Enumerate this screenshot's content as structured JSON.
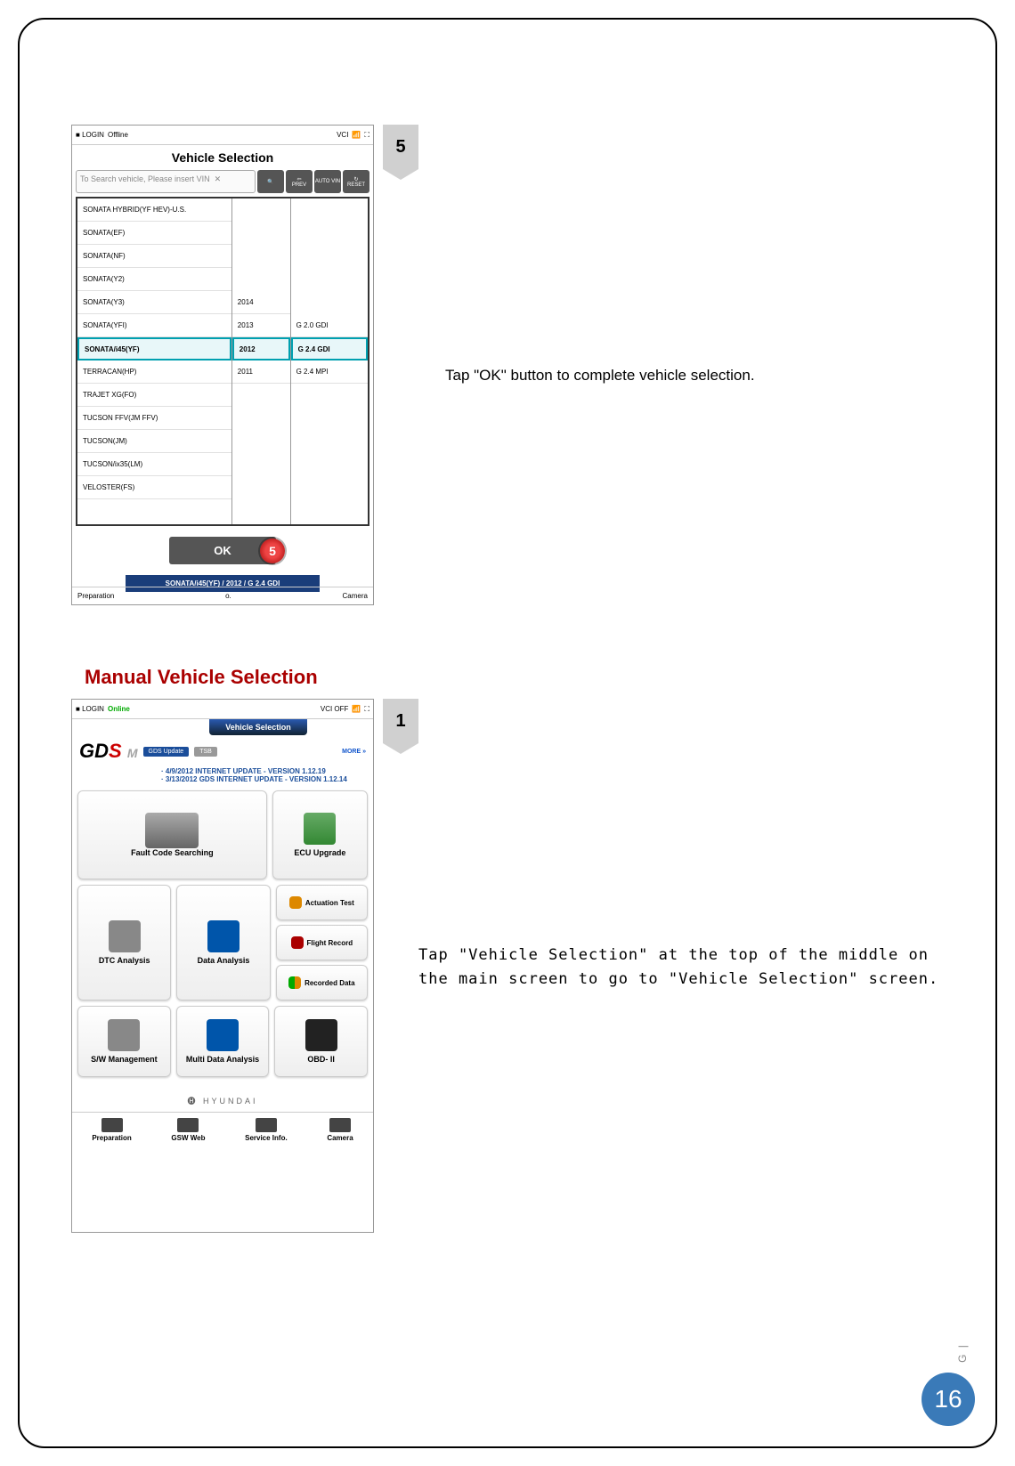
{
  "page_number": "16",
  "side_label": "G |",
  "section_title": "Manual Vehicle Selection",
  "steps": {
    "s5": {
      "num": "5",
      "text": "Tap \"OK\" button to complete vehicle selection."
    },
    "s1": {
      "num": "1",
      "text": "Tap \"Vehicle Selection\" at the top of the middle on the main screen to go to \"Vehicle Selection\" screen."
    }
  },
  "ss1": {
    "login": "LOGIN",
    "status": "Offline",
    "vci": "VCI",
    "title": "Vehicle Selection",
    "placeholder": "To Search vehicle, Please insert VIN",
    "btn_prev": "PREV",
    "btn_auto": "AUTO VIN",
    "btn_reset": "RESET",
    "vehicles": [
      "SONATA HYBRID(YF HEV)-U.S.",
      "SONATA(EF)",
      "SONATA(NF)",
      "SONATA(Y2)",
      "SONATA(Y3)",
      "SONATA(YFI)",
      "SONATA/i45(YF)",
      "TERRACAN(HP)",
      "TRAJET XG(FO)",
      "TUCSON FFV(JM FFV)",
      "TUCSON(JM)",
      "TUCSON/ix35(LM)",
      "VELOSTER(FS)"
    ],
    "selected_vehicle_index": 6,
    "years": [
      "2014",
      "2013",
      "2012",
      "2011"
    ],
    "selected_year_index": 2,
    "engines": [
      "G 2.0 GDI",
      "G 2.4 GDI",
      "G 2.4 MPI"
    ],
    "selected_engine_index": 1,
    "ok": "OK",
    "ok_marker": "5",
    "sel_label": "SONATA/i45(YF) / 2012 / G 2.4 GDI",
    "bot": {
      "left": "Preparation",
      "right": "Camera"
    }
  },
  "ss2": {
    "login": "LOGIN",
    "status": "Online",
    "vci": "VCI OFF",
    "tab": "Vehicle Selection",
    "pill1": "GDS Update",
    "pill2": "TSB",
    "more": "MORE »",
    "upd1": "· 4/9/2012  INTERNET UPDATE - VERSION 1.12.19",
    "upd2": "· 3/13/2012  GDS INTERNET UPDATE - VERSION 1.12.14",
    "tiles": {
      "fault": "Fault Code Searching",
      "ecu": "ECU Upgrade",
      "dtc": "DTC Analysis",
      "data": "Data Analysis",
      "act": "Actuation Test",
      "flight": "Flight Record",
      "rec": "Recorded Data",
      "sw": "S/W Management",
      "multi": "Multi Data Analysis",
      "obd": "OBD- II"
    },
    "brand": "HYUNDAI",
    "logo": {
      "g": "G",
      "d": "D",
      "s": "S",
      "m": "M"
    },
    "bottom": [
      "Preparation",
      "GSW Web",
      "Service Info.",
      "Camera"
    ]
  }
}
